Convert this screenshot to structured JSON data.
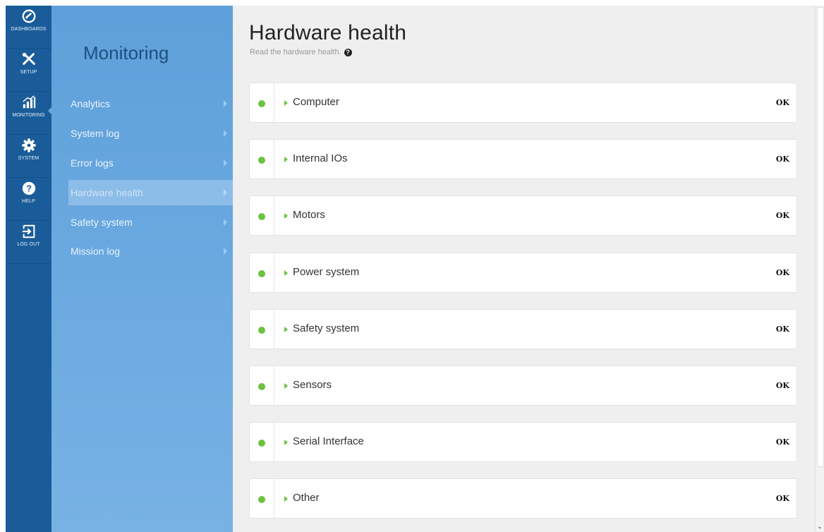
{
  "nav": {
    "items": [
      {
        "label": "DASHBOARDS",
        "icon": "dashboard-gauge-icon"
      },
      {
        "label": "SETUP",
        "icon": "tools-icon"
      },
      {
        "label": "MONITORING",
        "icon": "monitoring-bars-icon"
      },
      {
        "label": "SYSTEM",
        "icon": "gear-icon"
      },
      {
        "label": "HELP",
        "icon": "help-icon"
      },
      {
        "label": "LOG OUT",
        "icon": "logout-icon"
      }
    ],
    "active": "MONITORING"
  },
  "submenu": {
    "title": "Monitoring",
    "items": [
      {
        "label": "Analytics"
      },
      {
        "label": "System log"
      },
      {
        "label": "Error logs"
      },
      {
        "label": "Hardware health"
      },
      {
        "label": "Safety system"
      },
      {
        "label": "Mission log"
      }
    ],
    "active": "Hardware health"
  },
  "main": {
    "title": "Hardware health",
    "subtitle": "Read the hardware health.",
    "help_glyph": "?",
    "status_color": "#6dc23f",
    "components": [
      {
        "label": "Computer",
        "status": "OK"
      },
      {
        "label": "Internal IOs",
        "status": "OK"
      },
      {
        "label": "Motors",
        "status": "OK"
      },
      {
        "label": "Power system",
        "status": "OK"
      },
      {
        "label": "Safety system",
        "status": "OK"
      },
      {
        "label": "Sensors",
        "status": "OK"
      },
      {
        "label": "Serial Interface",
        "status": "OK"
      },
      {
        "label": "Other",
        "status": "OK"
      }
    ]
  },
  "scrollbar": {
    "down_arrow": "⌄"
  }
}
